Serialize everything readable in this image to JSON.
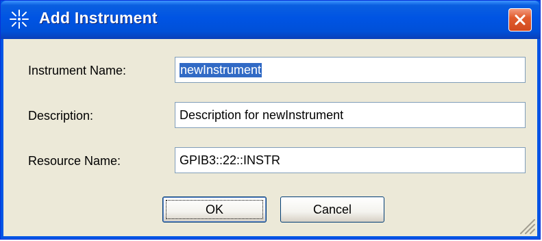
{
  "window": {
    "title": "Add Instrument"
  },
  "form": {
    "instrument_name": {
      "label": "Instrument Name:",
      "value": "newInstrument"
    },
    "description": {
      "label": "Description:",
      "value": "Description for newInstrument"
    },
    "resource_name": {
      "label": "Resource Name:",
      "value": "GPIB3::22::INSTR"
    }
  },
  "buttons": {
    "ok": "OK",
    "cancel": "Cancel"
  },
  "icons": {
    "app": "sparkle-icon",
    "close": "close-icon",
    "grip": "resize-grip-icon"
  },
  "colors": {
    "title_bar": "#0054e3",
    "client_bg": "#ece9d8",
    "selection": "#316ac5",
    "close_button": "#d14a1f"
  }
}
